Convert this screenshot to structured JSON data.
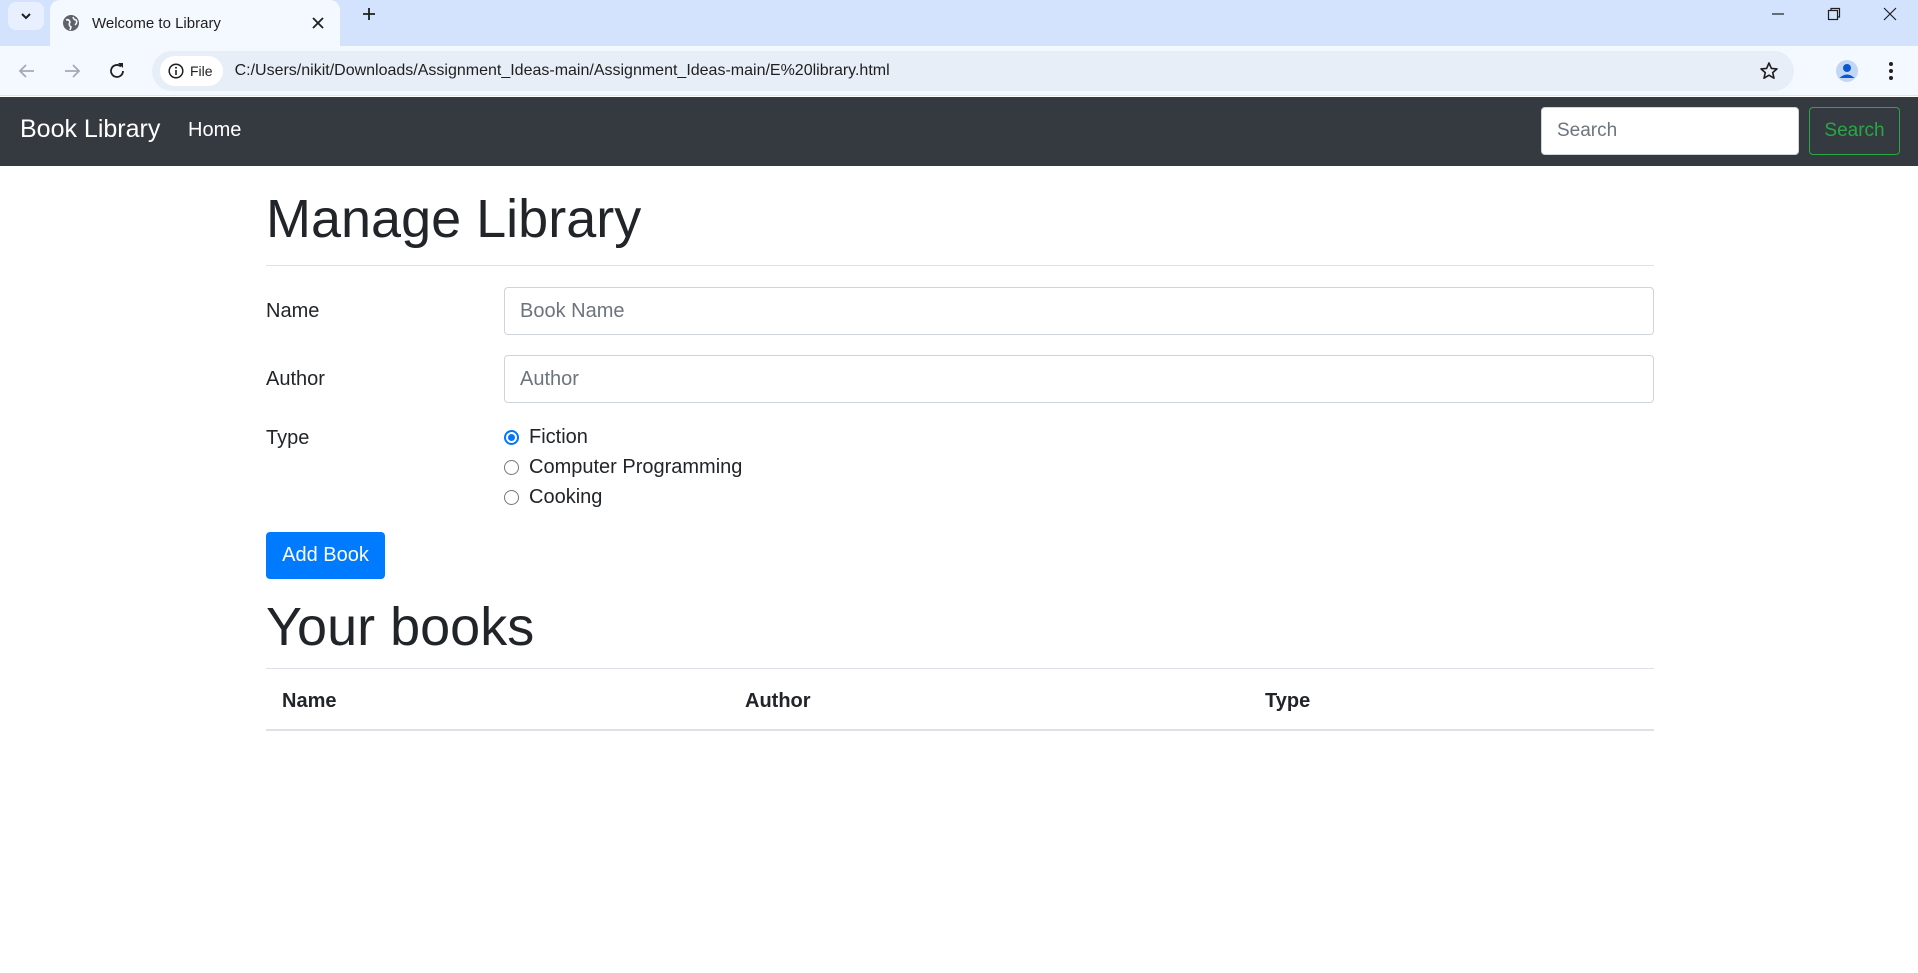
{
  "browser": {
    "tab_title": "Welcome to Library",
    "site_chip_label": "File",
    "url": "C:/Users/nikit/Downloads/Assignment_Ideas-main/Assignment_Ideas-main/E%20library.html"
  },
  "navbar": {
    "brand": "Book Library",
    "home_link": "Home",
    "search_placeholder": "Search",
    "search_button": "Search"
  },
  "main": {
    "title": "Manage Library",
    "form": {
      "name_label": "Name",
      "name_placeholder": "Book Name",
      "author_label": "Author",
      "author_placeholder": "Author",
      "type_label": "Type",
      "type_options": [
        {
          "label": "Fiction",
          "checked": true
        },
        {
          "label": "Computer Programming",
          "checked": false
        },
        {
          "label": "Cooking",
          "checked": false
        }
      ],
      "submit_label": "Add Book"
    },
    "books_title": "Your books",
    "table_headers": [
      "Name",
      "Author",
      "Type"
    ],
    "table_rows": []
  },
  "colors": {
    "navbar_bg": "#343a40",
    "primary": "#007bff",
    "success": "#28a745",
    "radio_accent": "#0075ff"
  }
}
